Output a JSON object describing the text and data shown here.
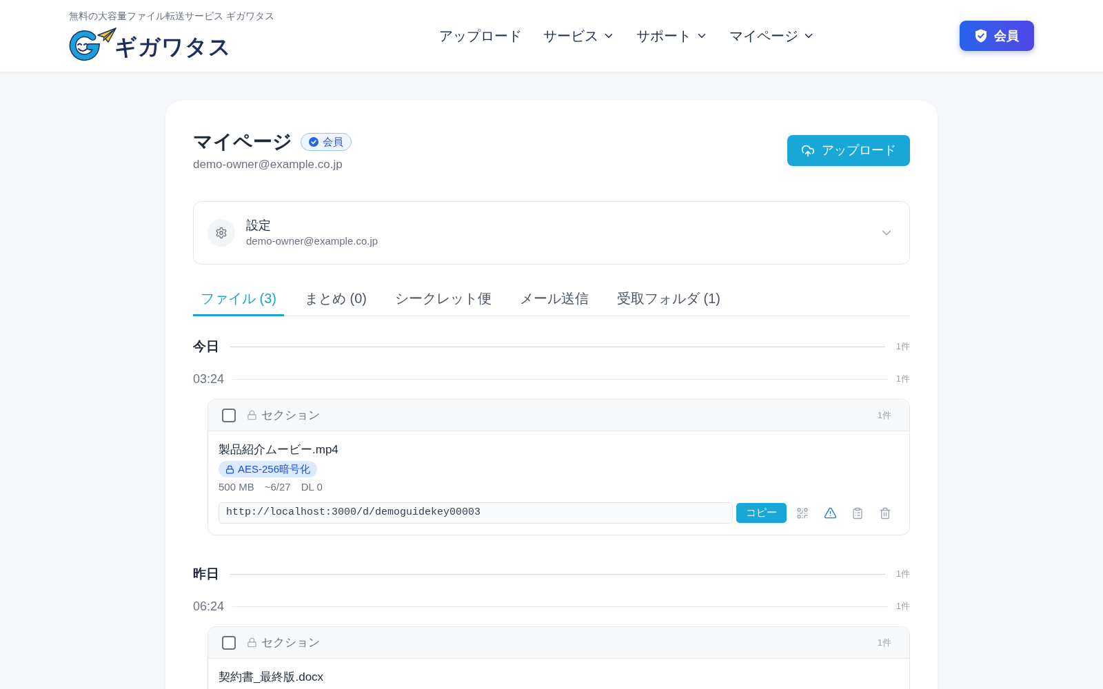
{
  "header": {
    "tagline": "無料の大容量ファイル転送サービス ギガワタス",
    "logo_text": "ギガワタス",
    "nav": [
      {
        "label": "アップロード",
        "has_menu": false
      },
      {
        "label": "サービス",
        "has_menu": true
      },
      {
        "label": "サポート",
        "has_menu": true
      },
      {
        "label": "マイページ",
        "has_menu": true
      }
    ],
    "member_button": "会員"
  },
  "profile": {
    "title": "マイページ",
    "badge": "会員",
    "email": "demo-owner@example.co.jp",
    "upload_button": "アップロード"
  },
  "settings": {
    "title": "設定",
    "email": "demo-owner@example.co.jp",
    "expanded": false
  },
  "tabs": [
    {
      "label": "ファイル (3)",
      "selected": true
    },
    {
      "label": "まとめ (0)",
      "selected": false
    },
    {
      "label": "シークレット便",
      "selected": false
    },
    {
      "label": "メール送信",
      "selected": false
    },
    {
      "label": "受取フォルダ (1)",
      "selected": false
    }
  ],
  "groups": [
    {
      "day": "今日",
      "count": "1件",
      "times": [
        {
          "time": "03:24",
          "count": "1件",
          "sections": [
            {
              "title": "セクション",
              "count": "1件",
              "checked": false,
              "files": [
                {
                  "name": "製品紹介ムービー.mp4",
                  "badge": "AES-256暗号化",
                  "meta": [
                    "500 MB",
                    "~6/27",
                    "DL 0"
                  ],
                  "url": "http://localhost:3000/d/demoguidekey00003",
                  "copy_button": "コピー"
                }
              ]
            }
          ]
        }
      ]
    },
    {
      "day": "昨日",
      "count": "1件",
      "times": [
        {
          "time": "06:24",
          "count": "1件",
          "sections": [
            {
              "title": "セクション",
              "count": "1件",
              "checked": false,
              "files": [
                {
                  "name": "契約書_最終版.docx"
                }
              ]
            }
          ]
        }
      ]
    }
  ]
}
